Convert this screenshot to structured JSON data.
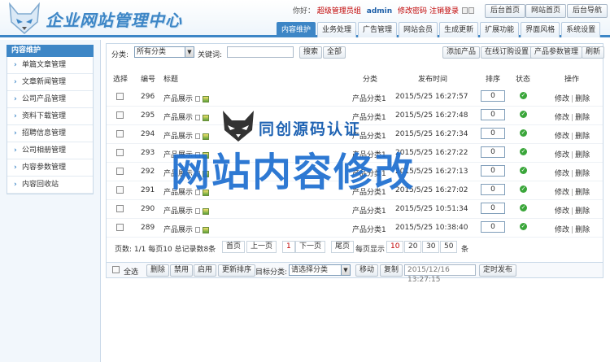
{
  "header": {
    "title": "企业网站管理中心",
    "greeting": "你好：",
    "role": "超级管理员组",
    "username": "admin",
    "change_password": "修改密码",
    "logout": "注销登录",
    "buttons": [
      "后台首页",
      "网站首页",
      "后台导航"
    ]
  },
  "tabs": [
    "内容维护",
    "业务处理",
    "广告管理",
    "网站会员",
    "生成更新",
    "扩展功能",
    "界面风格",
    "系统设置"
  ],
  "sidebar": {
    "title": "内容维护",
    "items": [
      "单篇文章管理",
      "文章新闻管理",
      "公司产品管理",
      "资料下载管理",
      "招聘信息管理",
      "公司相册管理",
      "内容参数管理",
      "内容回收站"
    ]
  },
  "toolbar": {
    "category_label": "分类:",
    "category_value": "所有分类",
    "keyword_label": "关键词:",
    "search_button": "搜索",
    "all_button": "全部",
    "add_product": "添加产品",
    "online_order_settings": "在线订购设置",
    "product_param_mgmt": "产品参数管理",
    "refresh": "刷新"
  },
  "table": {
    "headers": [
      "选择",
      "编号",
      "标题",
      "分类",
      "发布时间",
      "排序",
      "状态",
      "操作"
    ],
    "rows": [
      {
        "id": "296",
        "title": "产品展示",
        "category": "产品分类1",
        "time": "2015/5/25 16:27:57",
        "order": "0"
      },
      {
        "id": "295",
        "title": "产品展示",
        "category": "产品分类1",
        "time": "2015/5/25 16:27:48",
        "order": "0"
      },
      {
        "id": "294",
        "title": "产品展示",
        "category": "产品分类1",
        "time": "2015/5/25 16:27:34",
        "order": "0"
      },
      {
        "id": "293",
        "title": "产品展示",
        "category": "产品分类1",
        "time": "2015/5/25 16:27:22",
        "order": "0"
      },
      {
        "id": "292",
        "title": "产品展示",
        "category": "产品分类1",
        "time": "2015/5/25 16:27:13",
        "order": "0"
      },
      {
        "id": "291",
        "title": "产品展示",
        "category": "产品分类1",
        "time": "2015/5/25 16:27:02",
        "order": "0"
      },
      {
        "id": "290",
        "title": "产品展示",
        "category": "产品分类1",
        "time": "2015/5/25 10:51:34",
        "order": "0"
      },
      {
        "id": "289",
        "title": "产品展示",
        "category": "产品分类1",
        "time": "2015/5/25 10:38:40",
        "order": "0"
      }
    ],
    "edit": "修改",
    "delete": "删除",
    "status_icon": "check-circle-icon"
  },
  "pager": {
    "summary": "页数: 1/1 每页10 总记录数8条",
    "first": "首页",
    "prev": "上一页",
    "current": "1",
    "next": "下一页",
    "last": "尾页",
    "per_page_label": "每页显示",
    "sizes": [
      "10",
      "20",
      "30",
      "50"
    ],
    "unit": "条"
  },
  "actions": {
    "select_all": "全选",
    "delete": "删除",
    "disable": "禁用",
    "enable": "启用",
    "update_order": "更新排序",
    "target_category_label": "目标分类:",
    "target_category_value": "请选择分类",
    "move": "移动",
    "copy": "复制",
    "schedule_time": "2015/12/16 13:27:15",
    "schedule_publish": "定时发布"
  },
  "watermark": {
    "line1": "同创源码认证",
    "line2": "网站内容修改"
  },
  "colors": {
    "accent": "#3d86c6",
    "danger": "#c00000",
    "ok": "#3aa63a",
    "watermark": "#1f6fd0"
  }
}
